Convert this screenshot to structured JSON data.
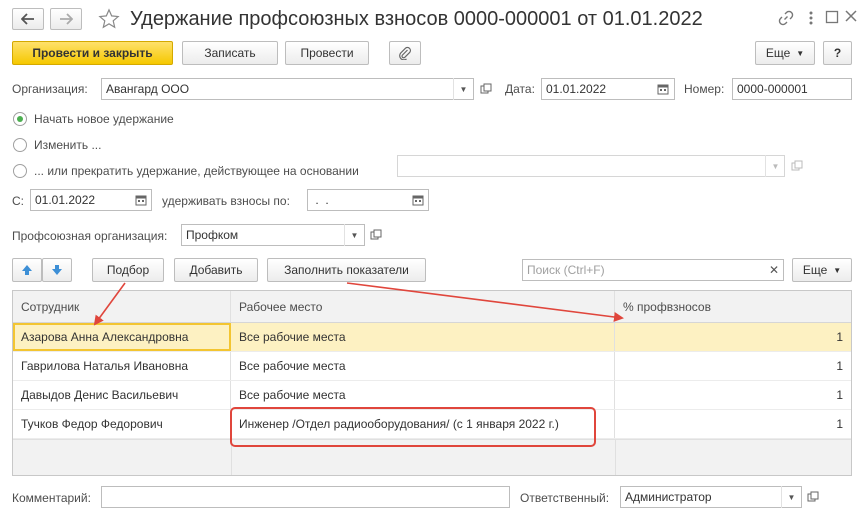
{
  "window": {
    "title": "Удержание профсоюзных взносов 0000-000001 от 01.01.2022"
  },
  "toolbar": {
    "post_close": "Провести и закрыть",
    "save": "Записать",
    "post": "Провести",
    "more": "Еще",
    "help": "?"
  },
  "form": {
    "org_label": "Организация:",
    "org_value": "Авангард ООО",
    "date_label": "Дата:",
    "date_value": "01.01.2022",
    "number_label": "Номер:",
    "number_value": "0000-000001",
    "radio_new": "Начать новое удержание",
    "radio_change": "Изменить ...",
    "radio_stop": "... или прекратить удержание, действующее на основании",
    "from_label": "С:",
    "from_value": "01.01.2022",
    "until_label": "удерживать взносы по:",
    "until_value": " .  .",
    "union_label": "Профсоюзная организация:",
    "union_value": "Профком"
  },
  "table_toolbar": {
    "pick": "Подбор",
    "add": "Добавить",
    "fill": "Заполнить показатели",
    "search_placeholder": "Поиск (Ctrl+F)",
    "more": "Еще"
  },
  "table": {
    "columns": [
      "Сотрудник",
      "Рабочее место",
      "% профвзносов"
    ],
    "rows": [
      {
        "employee": "Азарова Анна Александровна",
        "workplace": "Все рабочие места",
        "percent": "1"
      },
      {
        "employee": "Гаврилова Наталья Ивановна",
        "workplace": "Все рабочие места",
        "percent": "1"
      },
      {
        "employee": "Давыдов Денис Васильевич",
        "workplace": "Все рабочие места",
        "percent": "1"
      },
      {
        "employee": "Тучков Федор Федорович",
        "workplace": "Инженер /Отдел радиооборудования/ (с 1 января 2022 г.)",
        "percent": "1"
      }
    ]
  },
  "footer": {
    "comment_label": "Комментарий:",
    "comment_value": "",
    "responsible_label": "Ответственный:",
    "responsible_value": "Администратор"
  },
  "colors": {
    "primary_button": "#f5c800",
    "selected_row": "#fdf1c2",
    "annotation": "#e0463c",
    "radio_checked": "#4caf50",
    "arrow_blue": "#3d8fd6"
  }
}
